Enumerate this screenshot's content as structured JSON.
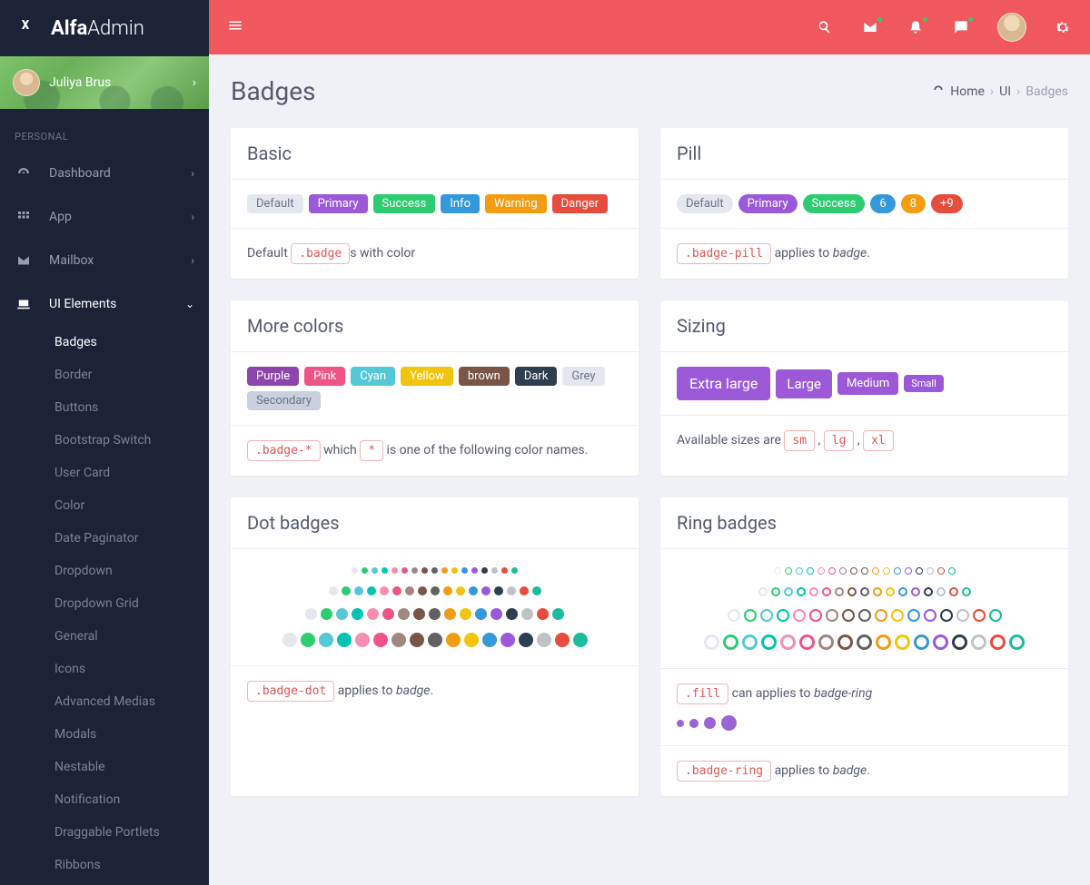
{
  "brand": {
    "bold": "Alfa",
    "light": "Admin"
  },
  "user": {
    "name": "Juliya Brus"
  },
  "nav": {
    "section": "PERSONAL",
    "items": [
      {
        "label": "Dashboard"
      },
      {
        "label": "App"
      },
      {
        "label": "Mailbox"
      },
      {
        "label": "UI Elements"
      }
    ],
    "ui_children": [
      "Badges",
      "Border",
      "Buttons",
      "Bootstrap Switch",
      "User Card",
      "Color",
      "Date Paginator",
      "Dropdown",
      "Dropdown Grid",
      "General",
      "Icons",
      "Advanced Medias",
      "Modals",
      "Nestable",
      "Notification",
      "Draggable Portlets",
      "Ribbons"
    ]
  },
  "page": {
    "title": "Badges"
  },
  "breadcrumb": {
    "home": "Home",
    "ui": "UI",
    "current": "Badges"
  },
  "cards": {
    "basic": {
      "title": "Basic",
      "badges": [
        "Default",
        "Primary",
        "Success",
        "Info",
        "Warning",
        "Danger"
      ],
      "footer_pre": "Default ",
      "code": ".badge",
      "footer_post": "s with color"
    },
    "pill": {
      "title": "Pill",
      "badges": [
        "Default",
        "Primary",
        "Success",
        "6",
        "8",
        "+9"
      ],
      "code": ".badge-pill",
      "footer_post": " applies to ",
      "footer_em": "badge",
      "footer_end": "."
    },
    "more": {
      "title": "More colors",
      "badges": [
        "Purple",
        "Pink",
        "Cyan",
        "Yellow",
        "brown",
        "Dark",
        "Grey",
        "Secondary"
      ],
      "code1": ".badge-*",
      "mid": " which ",
      "code2": "*",
      "post": " is one of the following color names."
    },
    "sizing": {
      "title": "Sizing",
      "badges": [
        "Extra large",
        "Large",
        "Medium",
        "Small"
      ],
      "pre": "Available sizes are ",
      "c1": "sm",
      "c2": "lg",
      "c3": "xl"
    },
    "dot": {
      "title": "Dot badges",
      "code": ".badge-dot",
      "post": " applies to ",
      "em": "badge",
      "end": "."
    },
    "ring": {
      "title": "Ring badges",
      "code1": ".fill",
      "mid1": " can applies to ",
      "em1": "badge-ring",
      "code2": ".badge-ring",
      "mid2": " applies to ",
      "em2": "badge",
      "end": "."
    }
  },
  "palette": [
    "#e5e7ef",
    "#2ecc71",
    "#55c8d8",
    "#00c3b3",
    "#f48fb1",
    "#ee5586",
    "#a1887f",
    "#795548",
    "#616161",
    "#f39c12",
    "#f1c40f",
    "#3498db",
    "#9b59d8",
    "#2c3e50",
    "#bdc3c7",
    "#e74c3c",
    "#1abc9c"
  ]
}
